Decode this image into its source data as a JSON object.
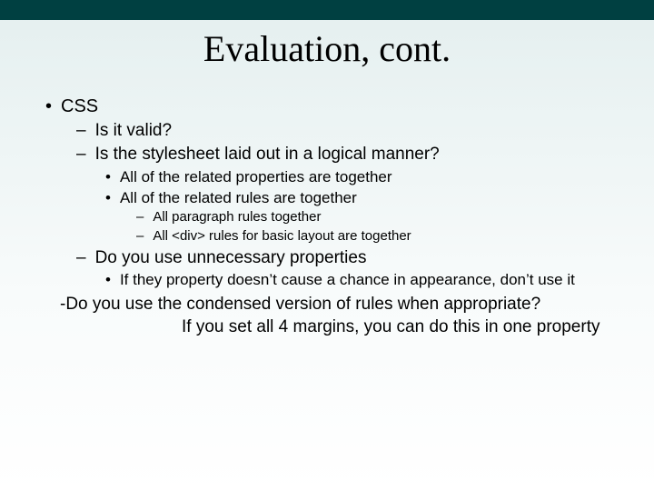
{
  "title": "Evaluation, cont.",
  "b1": "CSS",
  "b1_1": "Is it valid?",
  "b1_2": "Is the stylesheet laid out in a logical manner?",
  "b1_2_1": "All of the related properties are together",
  "b1_2_2": "All of the related rules are together",
  "b1_2_2_1": "All paragraph rules together",
  "b1_2_2_2": "All <div> rules for basic layout are together",
  "b1_3": "Do you use unnecessary properties",
  "b1_3_1": "If they property doesn’t cause a chance in appearance, don’t use it",
  "b1_4": "-Do you use the condensed version of rules when appropriate?",
  "b1_4_sub": "If you set all 4 margins, you can do this in one property"
}
